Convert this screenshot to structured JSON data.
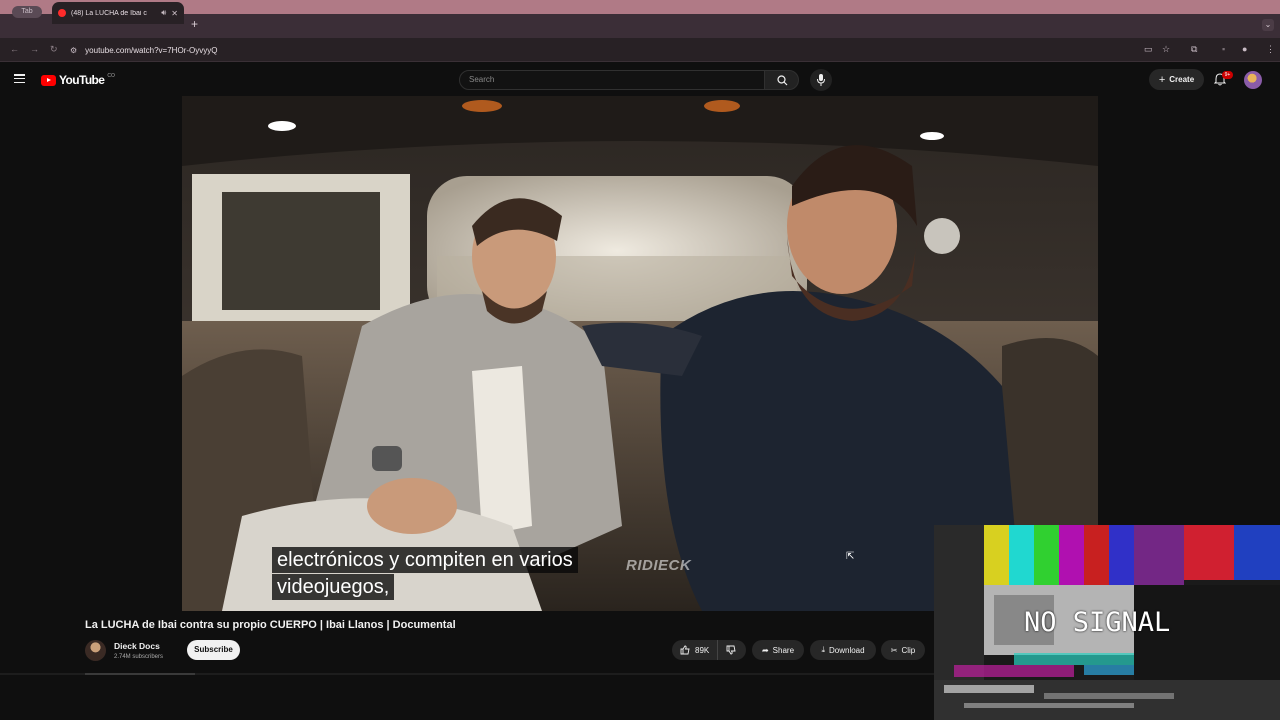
{
  "browser": {
    "tab_pill": "Tab",
    "tab_title": "(48) La LUCHA de Ibai c",
    "url": "youtube.com/watch?v=7HOr-OyvyyQ"
  },
  "header": {
    "logo_text": "YouTube",
    "logo_region": "CO",
    "search_placeholder": "Search",
    "create_label": "Create",
    "notifications_badge": "9+"
  },
  "player": {
    "caption_lines": [
      "electrónicos y compiten en varios",
      "videojuegos,"
    ],
    "watermark": "RIDIECK"
  },
  "video": {
    "title": "La LUCHA de Ibai contra su propio CUERPO | Ibai Llanos | Documental",
    "channel_name": "Dieck Docs",
    "subscribers": "2.74M subscribers",
    "subscribe_label": "Subscribe",
    "likes": "89K",
    "share_label": "Share",
    "download_label": "Download",
    "clip_label": "Clip"
  },
  "overlay": {
    "no_signal_text": "NO SIGNAL"
  },
  "colors": {
    "brand_red": "#ff0000",
    "background": "#0f0f0f"
  }
}
